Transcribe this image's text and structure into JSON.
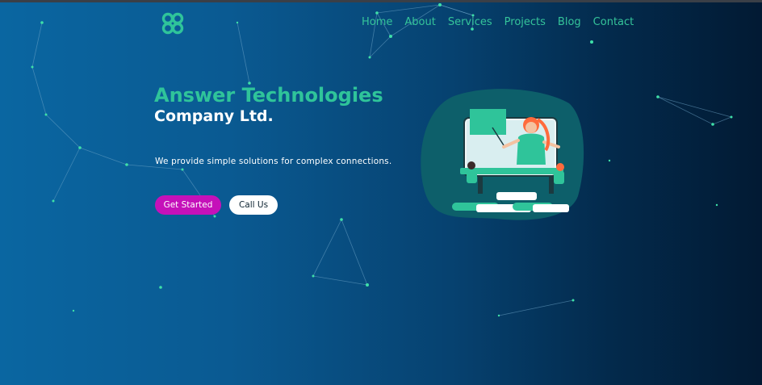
{
  "brand": {
    "logo_icon": "four-petal-knot-icon",
    "accent_color": "#2fc49a",
    "primary_button_color": "#c511b9"
  },
  "nav": {
    "items": [
      {
        "label": "Home"
      },
      {
        "label": "About"
      },
      {
        "label": "Services"
      },
      {
        "label": "Projects"
      },
      {
        "label": "Blog"
      },
      {
        "label": "Contact"
      }
    ]
  },
  "hero": {
    "title": "Answer Technologies",
    "subtitle": "Company Ltd.",
    "tagline": "We provide simple solutions for complex connections.",
    "primary_button": "Get Started",
    "secondary_button": "Call Us",
    "illustration": "online-teacher-illustration"
  }
}
